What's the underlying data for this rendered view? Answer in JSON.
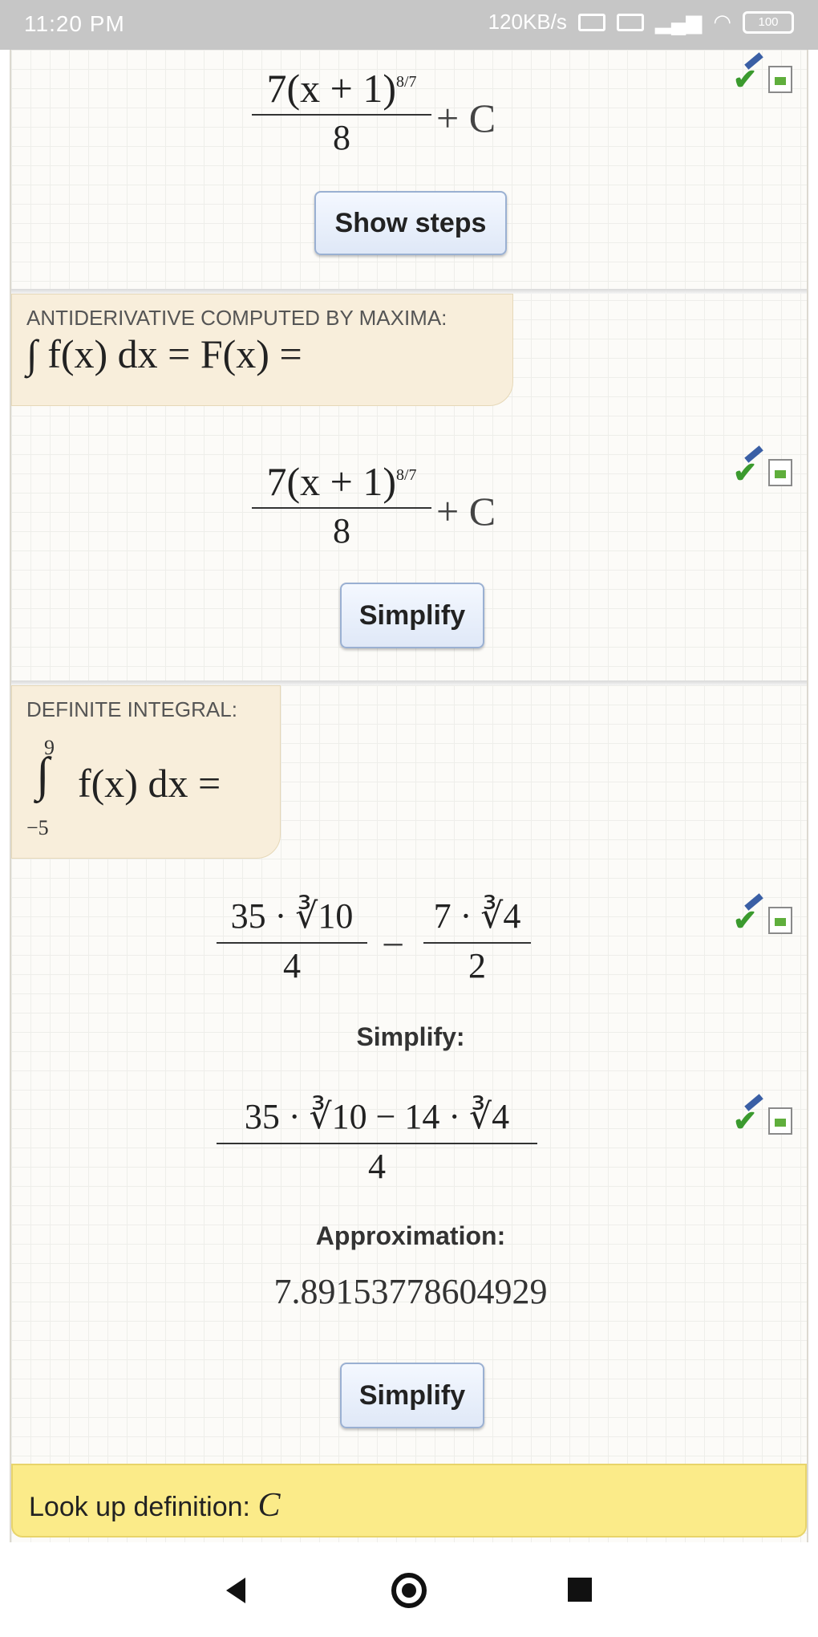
{
  "status_bar": {
    "time": "11:20 PM",
    "speed": "120KB/s",
    "battery": "100"
  },
  "result1": {
    "numerator": "7(x + 1)",
    "exponent": "8/7",
    "denominator": "8",
    "plus_c": "+ C",
    "button": "Show steps"
  },
  "antiderivative": {
    "label": "ANTIDERIVATIVE COMPUTED BY MAXIMA:",
    "formula": "∫ f(x) dx = F(x) =",
    "numerator": "7(x + 1)",
    "exponent": "8/7",
    "denominator": "8",
    "plus_c": "+ C",
    "button": "Simplify"
  },
  "definite": {
    "label": "DEFINITE INTEGRAL:",
    "upper": "9",
    "lower": "−5",
    "formula": "f(x) dx =",
    "frac1_num": "35 · ∛10",
    "frac1_den": "4",
    "minus": "−",
    "frac2_num": "7 · ∛4",
    "frac2_den": "2",
    "simplify_label": "Simplify:",
    "simplified_num": "35 · ∛10 − 14 · ∛4",
    "simplified_den": "4",
    "approx_label": "Approximation:",
    "approx_value": "7.89153778604929",
    "button": "Simplify"
  },
  "lookup": {
    "label": "Look up definition:",
    "term": "C"
  },
  "icons": {
    "check": "✔",
    "back": "back-icon",
    "home": "home-icon",
    "recent": "recent-apps-icon"
  }
}
